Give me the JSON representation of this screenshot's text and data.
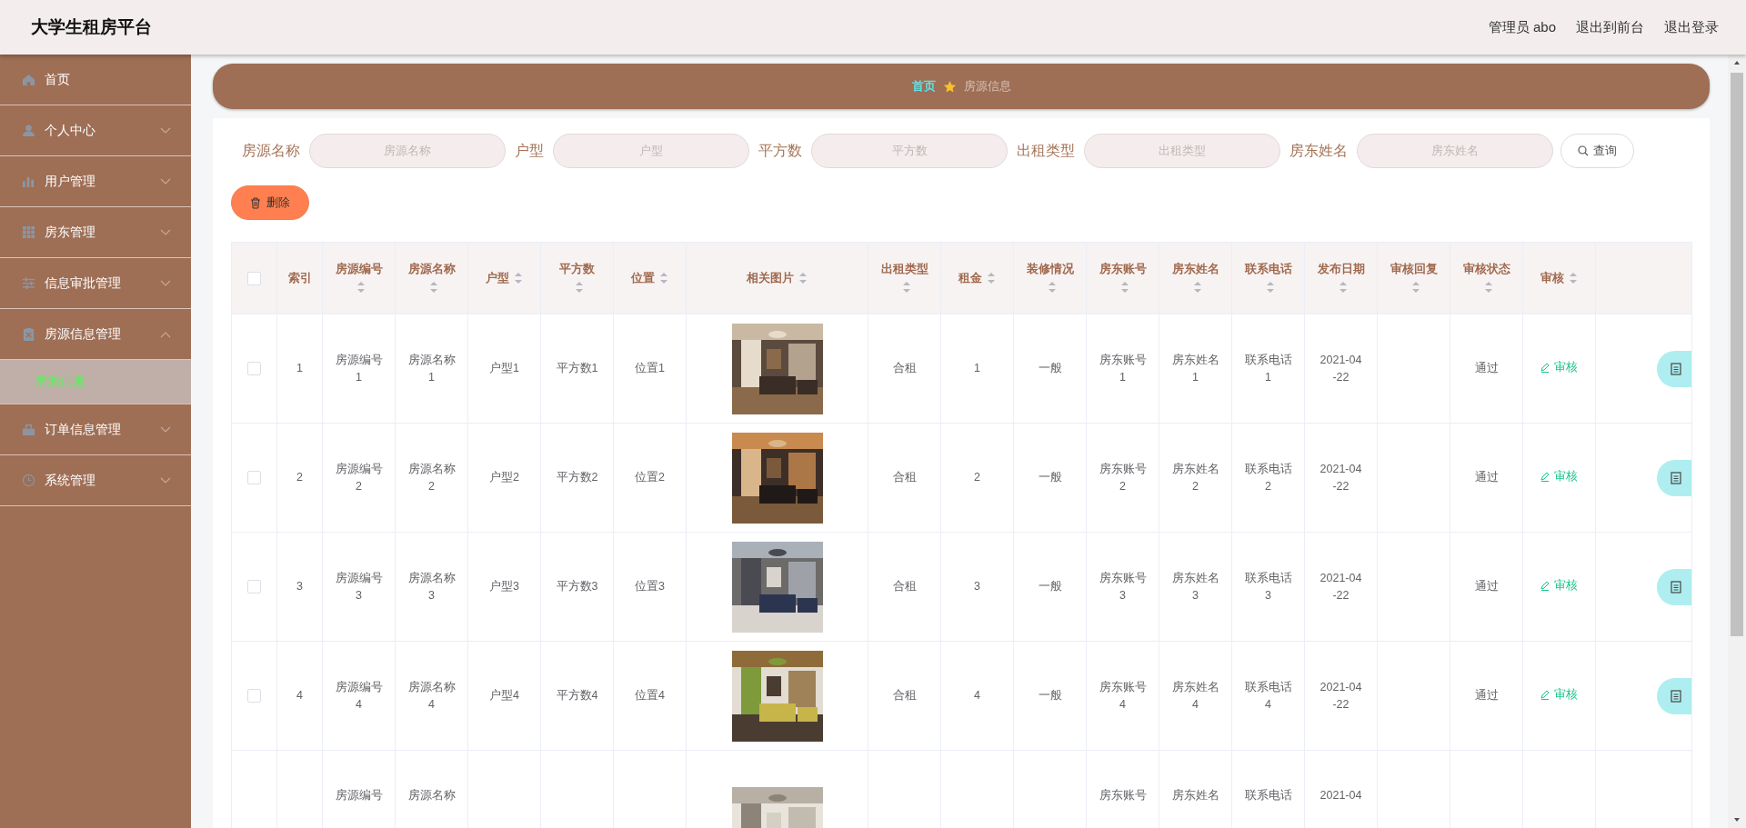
{
  "header": {
    "title": "大学生租房平台",
    "links": [
      "管理员 abo",
      "退出到前台",
      "退出登录"
    ]
  },
  "sidebar": {
    "items": [
      {
        "label": "首页"
      },
      {
        "label": "个人中心",
        "expanded": false
      },
      {
        "label": "用户管理",
        "expanded": false
      },
      {
        "label": "房东管理",
        "expanded": false
      },
      {
        "label": "信息审批管理",
        "expanded": false
      },
      {
        "label": "房源信息管理",
        "expanded": true,
        "children": [
          {
            "label": "房源信息",
            "selected": true
          }
        ]
      },
      {
        "label": "订单信息管理",
        "expanded": false
      },
      {
        "label": "系统管理",
        "expanded": false
      }
    ]
  },
  "breadcrumb": [
    "首页",
    "房源信息"
  ],
  "search": {
    "fields": [
      {
        "label": "房源名称",
        "placeholder": "房源名称"
      },
      {
        "label": "户型",
        "placeholder": "户型"
      },
      {
        "label": "平方数",
        "placeholder": "平方数"
      },
      {
        "label": "出租类型",
        "placeholder": "出租类型"
      },
      {
        "label": "房东姓名",
        "placeholder": "房东姓名"
      }
    ],
    "button": "查询"
  },
  "delete_button": "删除",
  "table": {
    "select_all_checked": false,
    "columns": [
      {
        "kind": "text",
        "label": "索引",
        "sortable": false
      },
      {
        "kind": "text",
        "label": "房源编号",
        "sortable": true
      },
      {
        "kind": "text",
        "label": "房源名称",
        "sortable": true
      },
      {
        "kind": "text",
        "label": "户型",
        "sortable": true
      },
      {
        "kind": "text",
        "label": "平方数",
        "sortable": true
      },
      {
        "kind": "text",
        "label": "位置",
        "sortable": true
      },
      {
        "kind": "picture",
        "label": "相关图片",
        "sortable": true
      },
      {
        "kind": "text",
        "label": "出租类型",
        "sortable": true
      },
      {
        "kind": "text",
        "label": "租金",
        "sortable": true
      },
      {
        "kind": "text",
        "label": "装修情况",
        "sortable": true
      },
      {
        "kind": "text",
        "label": "房东账号",
        "sortable": true
      },
      {
        "kind": "text",
        "label": "房东姓名",
        "sortable": true
      },
      {
        "kind": "text",
        "label": "联系电话",
        "sortable": true
      },
      {
        "kind": "date",
        "label": "发布日期",
        "sortable": true
      },
      {
        "kind": "text",
        "label": "审核回复",
        "sortable": true
      },
      {
        "kind": "text",
        "label": "审核状态",
        "sortable": true
      },
      {
        "kind": "link",
        "label": "审核",
        "sortable": true
      }
    ],
    "rows": [
      {
        "kind": "full",
        "checked": false,
        "index": "1",
        "code": "房源编号1",
        "name": "房源名称1",
        "layout": "户型1",
        "area": "平方数1",
        "location": "位置1",
        "rent_type": "合租",
        "rent": "1",
        "decoration": "一般",
        "landlord_account": "房东账号1",
        "landlord_name": "房东姓名1",
        "phone": "联系电话1",
        "date": "2021-04-22",
        "review_status": "通过",
        "review": "审核"
      },
      {
        "kind": "full",
        "checked": false,
        "index": "2",
        "code": "房源编号2",
        "name": "房源名称2",
        "layout": "户型2",
        "area": "平方数2",
        "location": "位置2",
        "rent_type": "合租",
        "rent": "2",
        "decoration": "一般",
        "landlord_account": "房东账号2",
        "landlord_name": "房东姓名2",
        "phone": "联系电话2",
        "date": "2021-04-22",
        "review_status": "通过",
        "review": "审核"
      },
      {
        "kind": "full",
        "checked": false,
        "index": "3",
        "code": "房源编号3",
        "name": "房源名称3",
        "layout": "户型3",
        "area": "平方数3",
        "location": "位置3",
        "rent_type": "合租",
        "rent": "3",
        "decoration": "一般",
        "landlord_account": "房东账号3",
        "landlord_name": "房东姓名3",
        "phone": "联系电话3",
        "date": "2021-04-22",
        "review_status": "通过",
        "review": "审核"
      },
      {
        "kind": "full",
        "checked": false,
        "index": "4",
        "code": "房源编号4",
        "name": "房源名称4",
        "layout": "户型4",
        "area": "平方数4",
        "location": "位置4",
        "rent_type": "合租",
        "rent": "4",
        "decoration": "一般",
        "landlord_account": "房东账号4",
        "landlord_name": "房东姓名4",
        "phone": "联系电话4",
        "date": "2021-04-22",
        "review_status": "通过",
        "review": "审核"
      },
      {
        "kind": "partial",
        "code": "房源编号",
        "name": "房源名称",
        "landlord_account": "房东账号",
        "landlord_name": "房东姓名",
        "phone": "联系电话",
        "date": "2021-04"
      }
    ]
  }
}
